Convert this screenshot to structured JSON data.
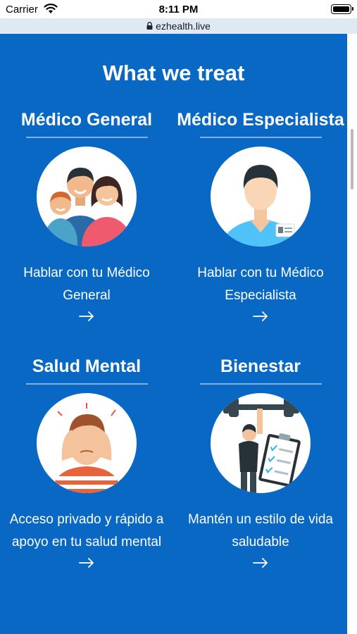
{
  "status_bar": {
    "carrier": "Carrier",
    "time": "8:11 PM"
  },
  "browser": {
    "url": "ezhealth.live"
  },
  "section": {
    "title": "What we treat"
  },
  "cards": [
    {
      "title": "Médico General",
      "description": "Hablar con tu Médico General",
      "illustration": "family-illustration"
    },
    {
      "title": "Médico Especialista",
      "description": "Hablar con tu Médico Especialista",
      "illustration": "doctor-illustration"
    },
    {
      "title": "Salud Mental",
      "description": "Acceso privado y rápido a apoyo en tu salud mental",
      "illustration": "stressed-person-illustration"
    },
    {
      "title": "Bienestar",
      "description": "Mantén un estilo de vida saludable",
      "illustration": "fitness-checklist-illustration"
    }
  ],
  "colors": {
    "background": "#0868c4",
    "text": "#ffffff",
    "divider": "#7fb0e0",
    "url_bar": "#dfe9f3"
  }
}
